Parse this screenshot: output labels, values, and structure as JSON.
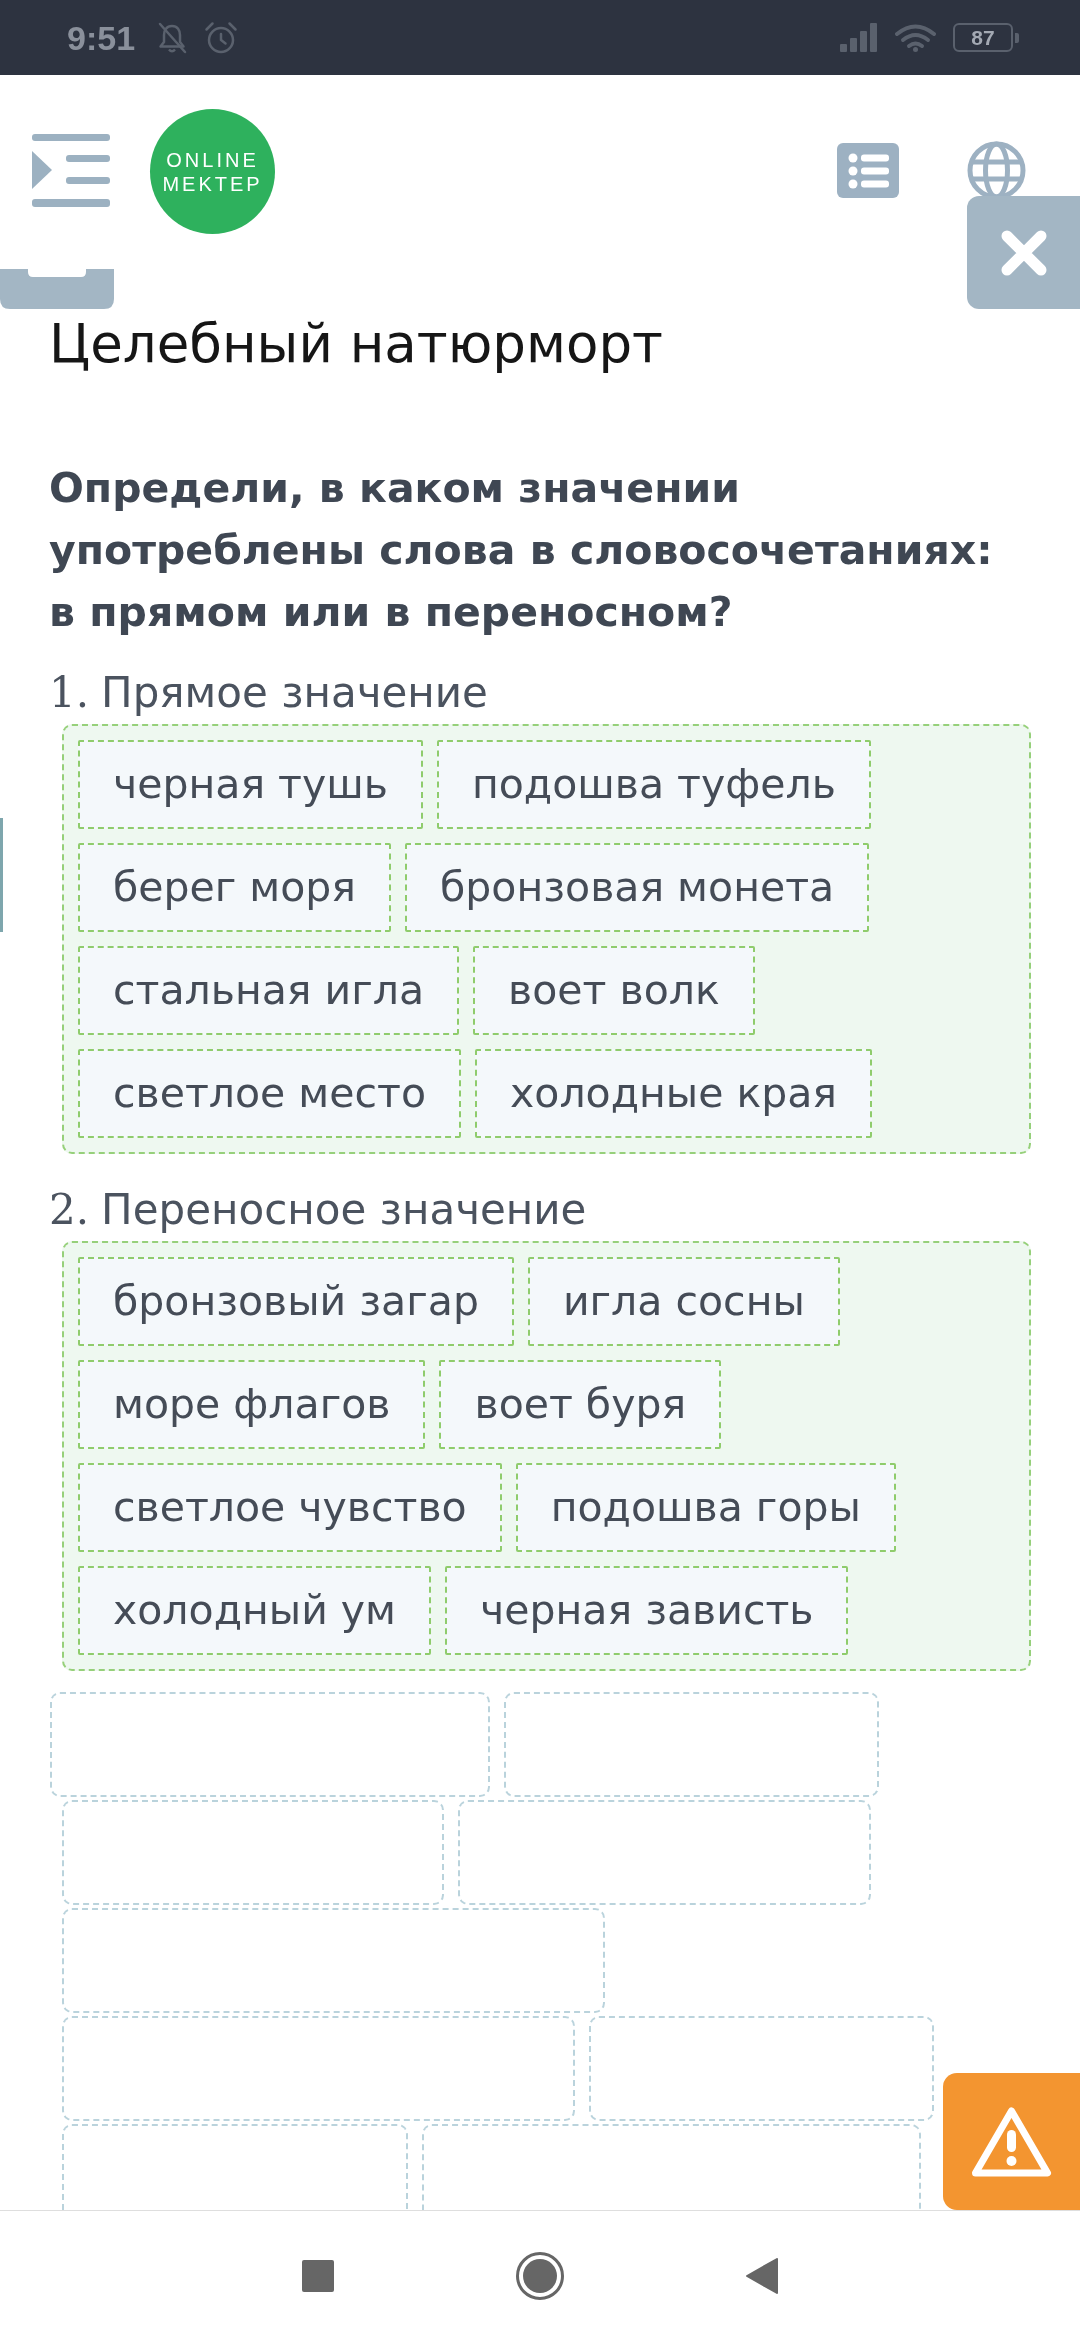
{
  "status_bar": {
    "time": "9:51",
    "battery": "87"
  },
  "header": {
    "logo": [
      "ONLINE",
      "MEKTEP"
    ]
  },
  "title": "Целебный натюрморт",
  "question": "Определи, в каком значении употреблены слова в словосочетаниях: в прямом или в переносном?",
  "groups": [
    {
      "number": "1.",
      "label": "Прямое значение",
      "items": [
        "черная тушь",
        "подошва туфель",
        "берег моря",
        "бронзовая монета",
        "стальная игла",
        "воет волк",
        "светлое место",
        "холодные края"
      ]
    },
    {
      "number": "2.",
      "label": "Переносное значение",
      "items": [
        "бронзовый загар",
        "игла сосны",
        "море флагов",
        "воет буря",
        "светлое чувство",
        "подошва горы",
        "холодный ум",
        "черная зависть"
      ]
    }
  ],
  "word_bank": [
    {
      "filled": false
    },
    {
      "filled": false
    },
    {
      "filled": false
    },
    {
      "filled": false
    },
    {
      "filled": false
    },
    {
      "filled": false
    },
    {
      "filled": false
    },
    {
      "filled": false
    },
    {
      "filled": false
    }
  ]
}
